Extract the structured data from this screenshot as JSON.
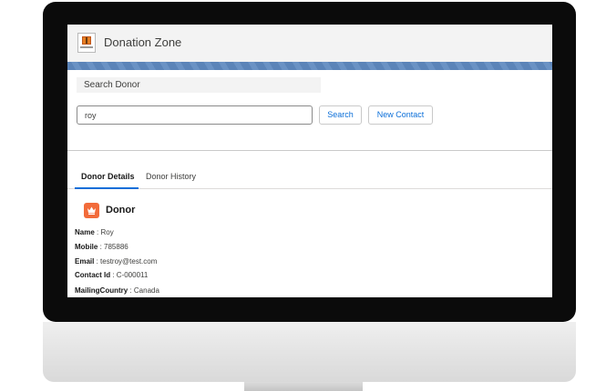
{
  "app": {
    "title": "Donation Zone"
  },
  "search": {
    "section_label": "Search Donor",
    "value": "roy",
    "search_button": "Search",
    "new_contact_button": "New Contact"
  },
  "tabs": [
    {
      "label": "Donor Details",
      "active": true
    },
    {
      "label": "Donor History",
      "active": false
    }
  ],
  "donor": {
    "heading": "Donor",
    "icon": "crown-icon",
    "fields": [
      {
        "label": "Name",
        "value": "Roy"
      },
      {
        "label": "Mobile",
        "value": "785886"
      },
      {
        "label": "Email",
        "value": "testroy@test.com"
      },
      {
        "label": "Contact Id",
        "value": "C-000011"
      },
      {
        "label": "MailingCountry",
        "value": "Canada"
      }
    ]
  },
  "colors": {
    "accent": "#0b6ed8",
    "banner": "#5b84b8",
    "donor_icon": "#f26b3a"
  }
}
